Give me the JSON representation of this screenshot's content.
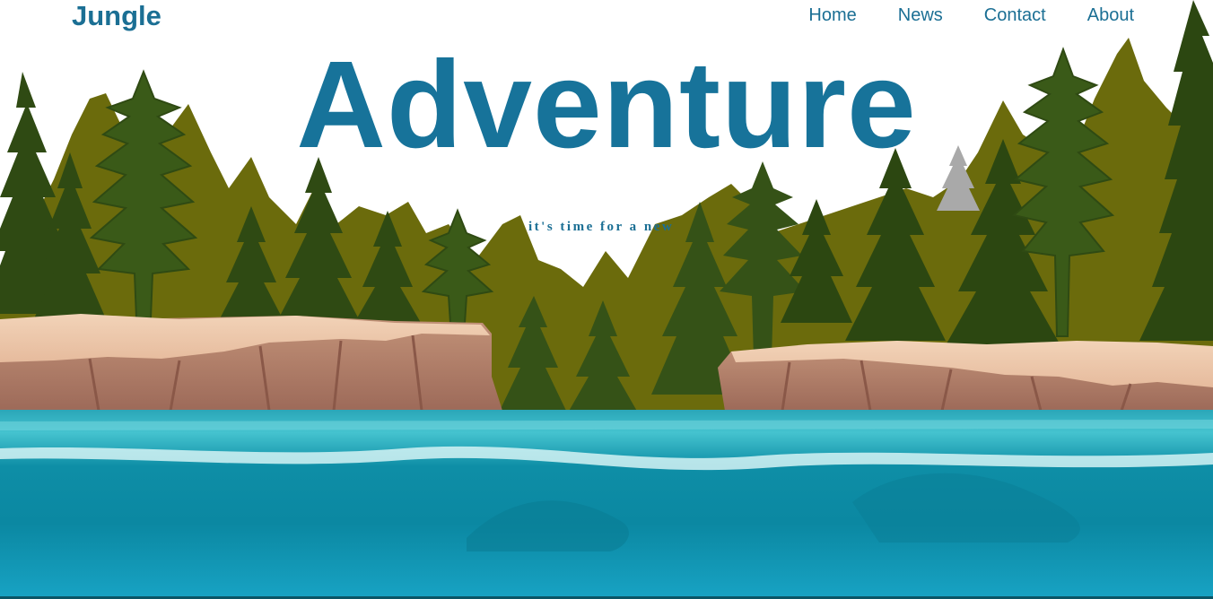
{
  "nav": {
    "brand": "Jungle",
    "links": [
      "Home",
      "News",
      "Contact",
      "About"
    ]
  },
  "hero": {
    "title": "Adventure",
    "tagline": "it's time for a new"
  },
  "colors": {
    "brand_blue": "#1b6f94",
    "forest_dark": "#2f4a13",
    "forest_olive": "#6b6b0c",
    "cliff": "#b47e68",
    "water": "#1593ad"
  }
}
